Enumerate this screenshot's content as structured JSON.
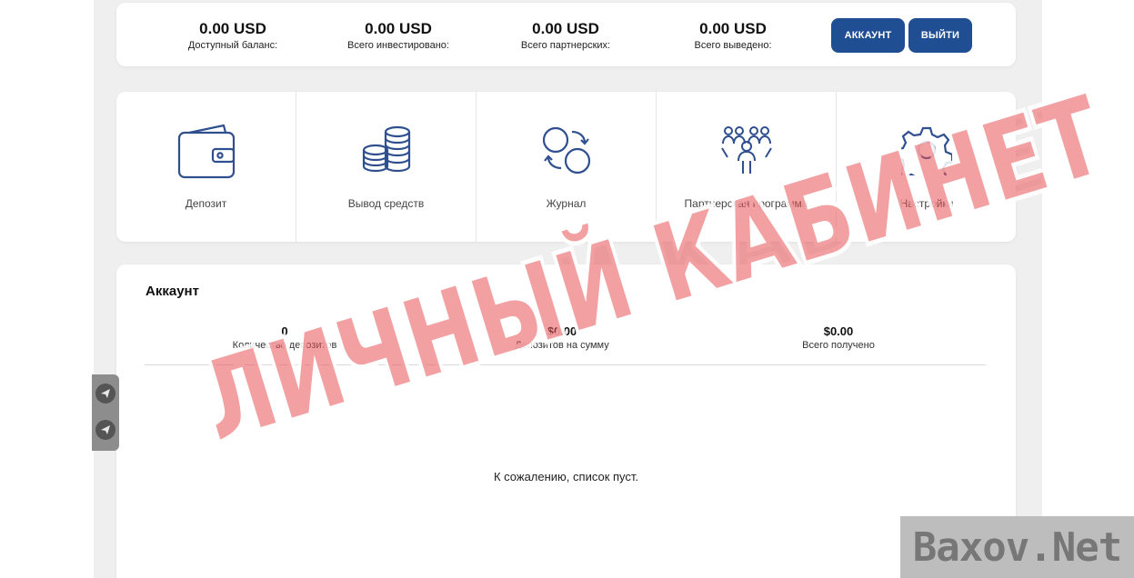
{
  "header": {
    "stats": [
      {
        "value": "0.00 USD",
        "label": "Доступный баланс:"
      },
      {
        "value": "0.00 USD",
        "label": "Всего инвестировано:"
      },
      {
        "value": "0.00 USD",
        "label": "Всего партнерских:"
      },
      {
        "value": "0.00 USD",
        "label": "Всего выведено:"
      }
    ],
    "account_button": "АККАУНТ",
    "logout_button": "ВЫЙТИ"
  },
  "menu": {
    "items": [
      {
        "label": "Депозит",
        "icon": "wallet-icon"
      },
      {
        "label": "Вывод средств",
        "icon": "coins-icon"
      },
      {
        "label": "Журнал",
        "icon": "exchange-icon"
      },
      {
        "label": "Партнерская программа",
        "icon": "team-icon"
      },
      {
        "label": "Настройки",
        "icon": "gear-icon"
      }
    ]
  },
  "account": {
    "title": "Аккаунт",
    "stats": [
      {
        "value": "0",
        "label": "Количество депозитов"
      },
      {
        "value": "$0.00",
        "label": "Депозитов на сумму"
      },
      {
        "value": "$0.00",
        "label": "Всего получено"
      }
    ],
    "empty_message": "К сожалению, список пуст."
  },
  "social": [
    "telegram-icon",
    "telegram-icon"
  ],
  "watermark": {
    "stamp": "ЛИЧНЫЙ КАБИНЕТ",
    "brand": "Baxov.Net"
  },
  "colors": {
    "primary": "#1f4e93",
    "icon_stroke": "#2f4f8f",
    "stamp": "#e95256"
  }
}
